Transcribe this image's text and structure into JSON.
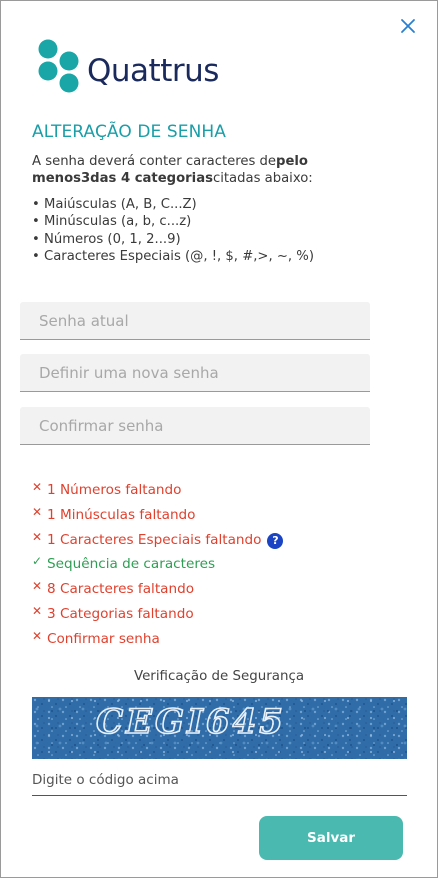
{
  "header": {
    "close_icon": "close-icon",
    "brand": "Quattrus",
    "logo_color": "#1aa6a6",
    "wordmark_color": "#1b2a5c"
  },
  "form": {
    "title": "ALTERAÇÃO DE SENHA",
    "intro": {
      "prefix": "A senha deverá conter caracteres de",
      "bold1": "pelo",
      "line2_bold": "menos3das 4 categorias",
      "suffix": "citadas abaixo:"
    },
    "rules": [
      "Maiúsculas (A, B, C...Z)",
      "Minúsculas (a, b, c...z)",
      "Números (0, 1, 2...9)",
      "Caracteres Especiais (@, !, $, #,>, ~, %)"
    ],
    "fields": {
      "current_password_placeholder": "Senha atual",
      "new_password_placeholder": "Definir uma nova senha",
      "confirm_password_placeholder": "Confirmar senha"
    },
    "validation": [
      {
        "status": "fail",
        "icon": "x-icon",
        "text": "1 Números faltando"
      },
      {
        "status": "fail",
        "icon": "x-icon",
        "text": "1 Minúsculas faltando"
      },
      {
        "status": "fail",
        "icon": "x-icon",
        "text": "1 Caracteres Especiais faltando",
        "help_icon": "help-icon"
      },
      {
        "status": "pass",
        "icon": "check-icon",
        "text": "Sequência de caracteres"
      },
      {
        "status": "fail",
        "icon": "x-icon",
        "text": "8 Caracteres faltando"
      },
      {
        "status": "fail",
        "icon": "x-icon",
        "text": "3 Categorias faltando"
      },
      {
        "status": "fail",
        "icon": "x-icon",
        "text": "Confirmar senha"
      }
    ],
    "fail_color": "#e0412e",
    "pass_color": "#2f9e54",
    "marks": {
      "fail": "✕",
      "pass": "✓",
      "help": "?"
    }
  },
  "security": {
    "title": "Verificação de Segurança",
    "captcha_text": "CEGI645",
    "captcha_input_placeholder": "Digite o código acima"
  },
  "actions": {
    "save_label": "Salvar",
    "save_color": "#4ab9b0"
  }
}
